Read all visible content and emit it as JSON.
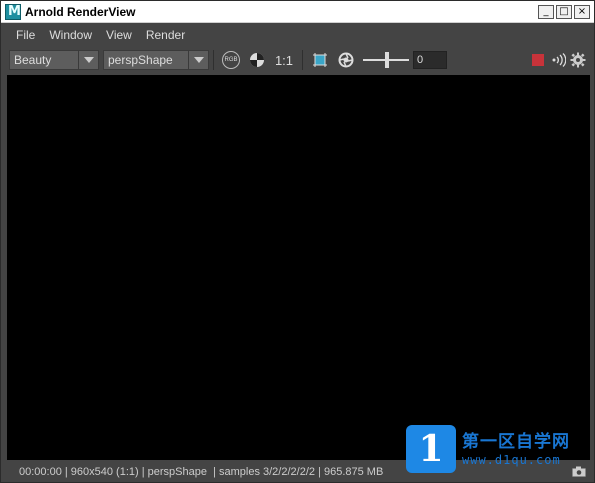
{
  "window": {
    "title": "Arnold RenderView",
    "minimize_label": "_",
    "maximize_label": "□",
    "close_label": "×"
  },
  "menubar": {
    "items": [
      {
        "label": "File"
      },
      {
        "label": "Window"
      },
      {
        "label": "View"
      },
      {
        "label": "Render"
      }
    ]
  },
  "toolbar": {
    "aov_value": "Beauty",
    "camera_value": "perspShape",
    "rgb_label": "RGB",
    "ratio_label": "1:1",
    "exposure_value": "0",
    "icons": [
      "rgb-channel-icon",
      "checker-icon",
      "crop-region-icon",
      "aperture-icon",
      "stop-render-icon",
      "ipr-signal-icon",
      "settings-gear-icon"
    ],
    "stop_color": "#c8333a"
  },
  "statusbar": {
    "text": "00:00:00 | 960x540 (1:1) | perspShape  | samples 3/2/2/2/2/2 | 965.875 MB"
  },
  "watermark": {
    "logo_text": "1",
    "title": "第一区自学网",
    "url": "www.d1qu.com"
  }
}
